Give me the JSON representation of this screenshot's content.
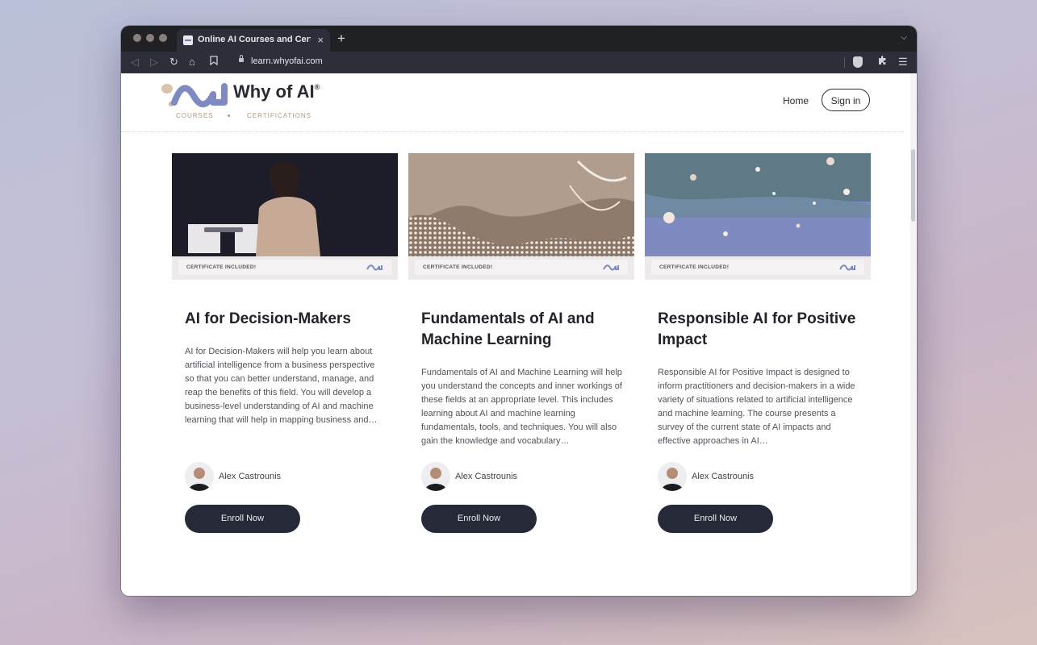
{
  "browser": {
    "tab_title": "Online AI Courses and Certifica",
    "tab_close": "×",
    "new_tab": "+",
    "url": "learn.whyofai.com"
  },
  "site": {
    "brand": "Why of AI",
    "brand_mark": "®",
    "subnav": [
      "COURSES",
      "CERTIFICATIONS"
    ],
    "nav_home": "Home",
    "sign_in": "Sign in"
  },
  "courses": [
    {
      "cert": "CERTIFICATE INCLUDED!",
      "title": "AI for Decision-Makers",
      "desc": "AI for Decision-Makers will help you learn about artificial intelligence from a business perspective so that you can better understand, manage, and reap the benefits of this field. You will develop a business-level understanding of AI and machine learning that will help in mapping business and…",
      "author": "Alex Castrounis",
      "cta": "Enroll Now"
    },
    {
      "cert": "CERTIFICATE INCLUDED!",
      "title": "Fundamentals of AI and Machine Learning",
      "desc": "Fundamentals of AI and Machine Learning will help you understand the concepts and inner workings of these fields at an appropriate level. This includes learning about AI and machine learning fundamentals, tools, and techniques. You will also gain the knowledge and vocabulary…",
      "author": "Alex Castrounis",
      "cta": "Enroll Now"
    },
    {
      "cert": "CERTIFICATE INCLUDED!",
      "title": "Responsible AI for Positive Impact",
      "desc": "Responsible AI for Positive Impact is designed to inform practitioners and decision-makers in a wide variety of situations related to artificial intelligence and machine learning. The course presents a survey of the current state of AI impacts and effective approaches in AI…",
      "author": "Alex Castrounis",
      "cta": "Enroll Now"
    }
  ],
  "colors": {
    "accent": "#7f8bc0",
    "button": "#262a38",
    "brand_tan": "#b5977d"
  }
}
